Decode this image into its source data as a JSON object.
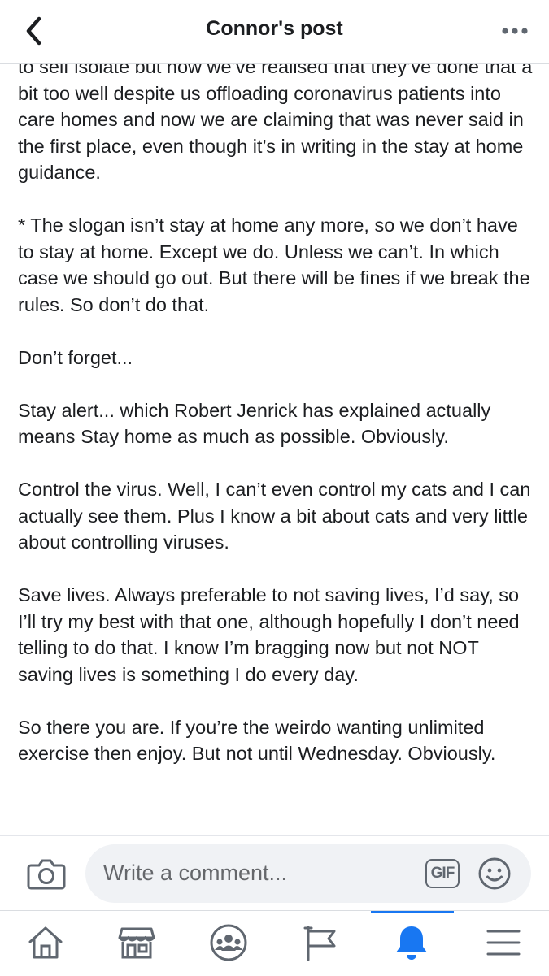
{
  "header": {
    "title": "Connor's post",
    "back_icon": "chevron-left-icon",
    "more_icon": "more-horizontal-icon"
  },
  "post": {
    "paragraphs": [
      "to self isolate but now we’ve realised that they’ve done that a bit too well despite us offloading coronavirus patients into care homes and now we are claiming that was never said in the first place, even though it’s in writing in the stay at home guidance.",
      "* The slogan isn’t stay at home any more, so we don’t have to stay at home. Except we do. Unless we can’t. In which case we should go out. But there will be fines if we break the rules. So don’t do that.",
      "Don’t forget...",
      "Stay alert... which Robert Jenrick has explained actually means Stay home as much as possible. Obviously.",
      "Control the virus. Well, I can’t even control my cats and I can actually see them. Plus I know a bit about cats and very little about controlling viruses.",
      "Save lives. Always preferable to not saving lives, I’d say, so I’ll try my best with that one, although hopefully I don’t need telling to do that. I know I’m bragging now but not NOT saving lives is something I do every day.",
      "So there you are. If you’re the weirdo wanting unlimited exercise then enjoy. But not until Wednesday. Obviously."
    ]
  },
  "comment_bar": {
    "placeholder": "Write a comment...",
    "gif_label": "GIF",
    "camera_icon": "camera-icon",
    "emoji_icon": "emoji-icon"
  },
  "tabs": [
    {
      "name": "home",
      "icon": "home-icon",
      "active": false
    },
    {
      "name": "marketplace",
      "icon": "marketplace-icon",
      "active": false
    },
    {
      "name": "groups",
      "icon": "groups-icon",
      "active": false
    },
    {
      "name": "pages",
      "icon": "flag-icon",
      "active": false
    },
    {
      "name": "notifications",
      "icon": "bell-icon",
      "active": true
    },
    {
      "name": "menu",
      "icon": "menu-icon",
      "active": false
    }
  ],
  "colors": {
    "accent": "#1877f2",
    "icon_gray": "#606770",
    "text": "#1c1e21",
    "placeholder": "#65676b",
    "input_bg": "#f0f2f5"
  }
}
